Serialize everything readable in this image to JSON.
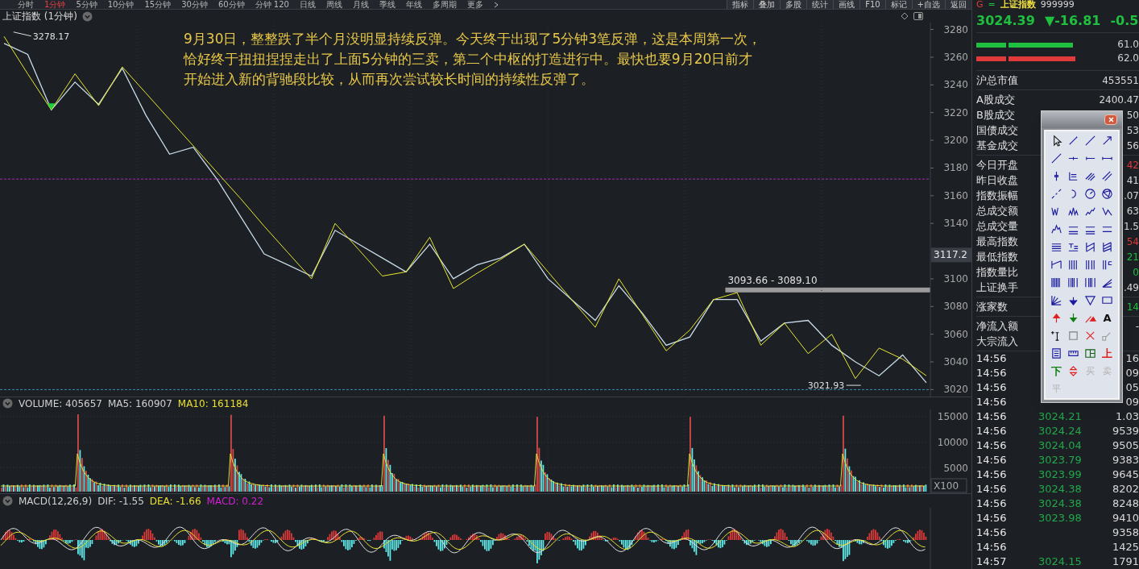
{
  "period_tabs": [
    {
      "label": "分时",
      "selected": false
    },
    {
      "label": "1分钟",
      "selected": true
    },
    {
      "label": "5分钟",
      "selected": false
    },
    {
      "label": "10分钟",
      "selected": false
    },
    {
      "label": "15分钟",
      "selected": false
    },
    {
      "label": "30分钟",
      "selected": false
    },
    {
      "label": "60分钟",
      "selected": false
    },
    {
      "label": "分钟 120",
      "selected": false
    },
    {
      "label": "日线",
      "selected": false
    },
    {
      "label": "周线",
      "selected": false
    },
    {
      "label": "月线",
      "selected": false
    },
    {
      "label": "季线",
      "selected": false
    },
    {
      "label": "年线",
      "selected": false
    },
    {
      "label": "多周期",
      "selected": false
    },
    {
      "label": "更多",
      "selected": false
    }
  ],
  "toolbar_buttons": [
    "指标",
    "叠加",
    "多股",
    "统计",
    "画线",
    "F10",
    "标记",
    "+自选",
    "返回"
  ],
  "chart_title": "上证指数 (1分钟)",
  "note_lines": [
    "9月30日，整整跌了半个月没明显持续反弹。今天终于出现了5分钟3笔反弹，这是本周第一次，",
    "恰好终于扭扭捏捏走出了上面5分钟的三卖，第二个中枢的打造进行中。最快也要9月20日前才",
    "开始进入新的背驰段比较，从而再次尝试较长时间的持续性反弹了。"
  ],
  "price_chart": {
    "labels": {
      "high": "3278.17",
      "band": "3093.66 - 3089.10",
      "low": "3021.93",
      "cursor": "3117.2"
    },
    "chart_data": {
      "type": "line",
      "ylim": [
        3015,
        3285
      ],
      "yticks": [
        3020,
        3040,
        3060,
        3080,
        3100,
        3140,
        3160,
        3180,
        3200,
        3220,
        3240,
        3260,
        3280
      ],
      "series": [
        {
          "color": "#c8dce8",
          "values": [
            3270,
            3262,
            3222,
            3242,
            3226,
            3252,
            3218,
            3190,
            3195,
            3172,
            3145,
            3118,
            3110,
            3102,
            3135,
            3125,
            3115,
            3105,
            3125,
            3100,
            3110,
            3115,
            3125,
            3100,
            3085,
            3070,
            3095,
            3075,
            3052,
            3058,
            3085,
            3085,
            3055,
            3068,
            3070,
            3052,
            3040,
            3030,
            3045,
            3025
          ]
        },
        {
          "color": "#e8e830",
          "values": [
            3275,
            3248,
            3222,
            3248,
            3225,
            3253,
            3234,
            3215,
            3196,
            3177,
            3158,
            3138,
            3119,
            3100,
            3140,
            3121,
            3102,
            3105,
            3130,
            3093,
            3104,
            3114,
            3125,
            3105,
            3085,
            3065,
            3100,
            3074,
            3048,
            3063,
            3085,
            3090,
            3052,
            3068,
            3046,
            3060,
            3028,
            3050,
            3042,
            3030
          ]
        }
      ]
    }
  },
  "volume": {
    "legend": [
      {
        "label": "VOLUME: 405657",
        "color": "#d0d0d0"
      },
      {
        "label": "MA5: 160907",
        "color": "#d0d0d0"
      },
      {
        "label": "MA10: 161184",
        "color": "#e8e030"
      }
    ],
    "ticks": [
      "15000",
      "10000",
      "5000"
    ],
    "unit": "X100"
  },
  "macd": {
    "legend": [
      {
        "label": "MACD(12,26,9)",
        "color": "#d0d0d0"
      },
      {
        "label": "DIF: -1.55",
        "color": "#d0d0d0"
      },
      {
        "label": "DEA: -1.66",
        "color": "#e8e030"
      },
      {
        "label": "MACD: 0.22",
        "color": "#d020d0"
      }
    ]
  },
  "quote": {
    "flag": "G",
    "eq": "=",
    "name": "上证指数",
    "code": "999999",
    "price": "3024.39",
    "change": "▼-16.81",
    "pct": "-0.5"
  },
  "ratio_bars": [
    {
      "color": "#1fbf3f",
      "level": 0.8,
      "reading": "61.0"
    },
    {
      "color": "#e03a3a",
      "level": 0.82,
      "reading": "62.0"
    }
  ],
  "stat_groups": [
    [
      {
        "label": "沪总市值",
        "value": "453551",
        "kind": "flat"
      }
    ],
    [
      {
        "label": "A股成交",
        "value": "2400.47",
        "kind": "flat"
      },
      {
        "label": "B股成交",
        "value": "50",
        "kind": "flat"
      },
      {
        "label": "国债成交",
        "value": "53",
        "kind": "flat"
      },
      {
        "label": "基金成交",
        "value": "56",
        "kind": "flat"
      }
    ],
    [
      {
        "label": "今日开盘",
        "value": "42",
        "kind": "up"
      },
      {
        "label": "昨日收盘",
        "value": "41",
        "kind": "flat"
      },
      {
        "label": "指数振幅",
        "value": ".07",
        "kind": "flat"
      },
      {
        "label": "总成交额",
        "value": "63",
        "kind": "flat"
      },
      {
        "label": "总成交量",
        "value": "1.5",
        "kind": "flat"
      },
      {
        "label": "最高指数",
        "value": "54",
        "kind": "up"
      },
      {
        "label": "最低指数",
        "value": "21",
        "kind": "down"
      },
      {
        "label": "指数量比",
        "value": "0",
        "kind": "down"
      },
      {
        "label": "上证换手",
        "value": ".49",
        "kind": "flat"
      }
    ],
    [
      {
        "label": "涨家数",
        "value": "14",
        "kind": "down"
      }
    ],
    [
      {
        "label": "净流入额",
        "value": "-",
        "kind": "flat"
      },
      {
        "label": "大宗流入"
      }
    ]
  ],
  "ticks": [
    {
      "time": "14:56",
      "volume": "16"
    },
    {
      "time": "14:56",
      "volume": "09"
    },
    {
      "time": "14:56",
      "volume": "05"
    },
    {
      "time": "14:56",
      "volume": "09"
    },
    {
      "time": "14:56",
      "price": "3024.21",
      "volume": "1.03"
    },
    {
      "time": "14:56",
      "price": "3024.24",
      "volume": "9539"
    },
    {
      "time": "14:56",
      "price": "3024.04",
      "volume": "9505"
    },
    {
      "time": "14:56",
      "price": "3023.79",
      "volume": "9383"
    },
    {
      "time": "14:56",
      "price": "3023.99",
      "volume": "9645"
    },
    {
      "time": "14:56",
      "price": "3024.38",
      "volume": "8202"
    },
    {
      "time": "14:56",
      "price": "3024.38",
      "volume": "8248"
    },
    {
      "time": "14:56",
      "price": "3023.98",
      "volume": "9410"
    },
    {
      "time": "14:56",
      "volume": "9358"
    },
    {
      "time": "14:56",
      "volume": "1425"
    },
    {
      "time": "14:57",
      "price": "3024.15",
      "volume": "1791"
    }
  ],
  "toolbox": {
    "glyphs": [
      {
        "char": "A",
        "color": "#101010"
      },
      {
        "char": "上",
        "color": "#e02020"
      },
      {
        "char": "下",
        "color": "#108010"
      }
    ],
    "trade_buttons": [
      {
        "label": "买",
        "disabled": true
      },
      {
        "label": "卖",
        "disabled": true
      },
      {
        "label": "平",
        "disabled": true
      }
    ]
  }
}
